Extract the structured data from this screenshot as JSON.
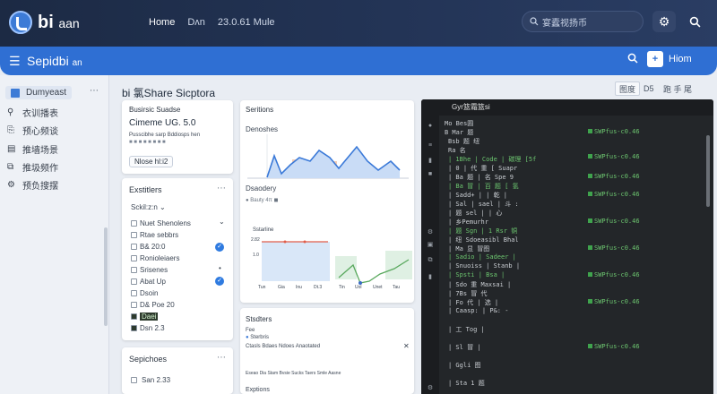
{
  "header": {
    "logo_text": "bi",
    "logo_sub": "aan",
    "nav": [
      "Home",
      "Dʌn",
      "23.0.61 Mule"
    ],
    "search_placeholder": "宴蠹视扬币",
    "icons": [
      "gear-icon",
      "search-icon"
    ]
  },
  "appbar": {
    "title": "Sepidbi",
    "title_sub": "an",
    "home_label": "Hiom",
    "home_box": "+"
  },
  "sidebar": {
    "items": [
      {
        "label": "Dumyeast",
        "icon": "folder-icon"
      },
      {
        "label": "衣训播表",
        "icon": "location-icon"
      },
      {
        "label": "预心频谈",
        "icon": "doc-icon"
      },
      {
        "label": "推墙场景",
        "icon": "chart-icon"
      },
      {
        "label": "推圾频作",
        "icon": "copy-icon"
      },
      {
        "label": "预负搜摆",
        "icon": "gear-icon"
      }
    ]
  },
  "page": {
    "title": "bi 氯Share Sicptora",
    "controls": [
      "图度",
      "D5",
      "跑 手 尾"
    ]
  },
  "card1": {
    "subtitle": "Busirsic   Suadse",
    "name": "Cimeme UG. 5.0",
    "line1": "Pusscibhe   sarp   Bddiosps   hen",
    "line2": "■  ■  ■  ■  ■  ■  ■  ■",
    "button": "Nlose hl:i2"
  },
  "card2": {
    "title": "Exstitlers",
    "select": "Sckil:z:n",
    "items": [
      {
        "label": "Nuet Shenolens",
        "checked": false
      },
      {
        "label": "Rtae sebbrs",
        "checked": false
      },
      {
        "label": "B& 20:0",
        "checked": true
      },
      {
        "label": "Ronioleiaers",
        "checked": false
      },
      {
        "label": "Srisenes",
        "checked": false
      },
      {
        "label": "Abat Up",
        "checked": true
      },
      {
        "label": "Dsoin",
        "checked": false
      },
      {
        "label": "D& Poe 20",
        "checked": false
      },
      {
        "label": "Daei",
        "checked": false
      },
      {
        "label": "Dsn 2.3",
        "checked": false
      }
    ]
  },
  "card3": {
    "title": "Sepichoes",
    "value": "San 2.33"
  },
  "chart_panel": {
    "title": "Seritions",
    "subtitle": "Denoshes",
    "desc": "Dsaodery",
    "legend": "●  Bauty   4π   ◼"
  },
  "mini_charts": {
    "title": "Sstarline",
    "y_labels": [
      "2.82",
      "1.0"
    ],
    "x_labels": [
      "Tun",
      "Gia",
      "Inu",
      "Dt.3"
    ],
    "right_x": [
      "Tin",
      "Uol",
      "Unet",
      "Tau"
    ]
  },
  "card5": {
    "title": "Stsdters",
    "sub": "Fee",
    "legend": "Sterbris",
    "row1": "Ctasls   Bdaes Ndoes   Anaotated",
    "row2": "Eseao  Dia  Stam  Bvsie  Sucks  Taers  Smle  Aasne",
    "footer": "Exptions"
  },
  "terminal": {
    "title": "Gyr篮霜篮si",
    "lines": [
      "Mo Bes圆",
      "B Mar  题",
      "Bsb 题 纽",
      "Ra 名",
      "| 1Bhe  | Code  | 碳理 [5f",
      "| 0 | 代 重  [  Suapr",
      "| Ba 题 | 名 Spe 9",
      "| Ba 冒 | 百 题 [ 氢",
      "| Sadd+  | | 乾  |",
      "| Sal  | sael  | 斗 :",
      "| 题 sel  | | 心",
      "| 乡Pemurhr",
      "| 题 Sgn | 1 Rsr 铜",
      "| 纽 Sdoeasibl  Bhal",
      "| Ma 显 冒图",
      "| Sadio | Sadeer  |",
      "| Snuoiss | Stanb |",
      "| Spsti  | Bsa  |",
      "| Sdo 重 Maxsai  |",
      "| 7Bs 冒 代",
      "| Fo 代  | 选  |",
      "| Caasp: | P&: -",
      "| 工 Tog  |",
      "| Sl 冒  |",
      "| Ggli  图",
      "| Sta  1 题"
    ],
    "right_lines": [
      "SWPfus-c0.46",
      "SWPfus-c0.46",
      "SWPfus-c0.46",
      "SWPfus-c0.46",
      "SWPfus-c0.46",
      "SWPfus-c0.46",
      "SWPfus-c0.46",
      "SWPfus-c0.46",
      "SWPfus-c0.46"
    ]
  }
}
